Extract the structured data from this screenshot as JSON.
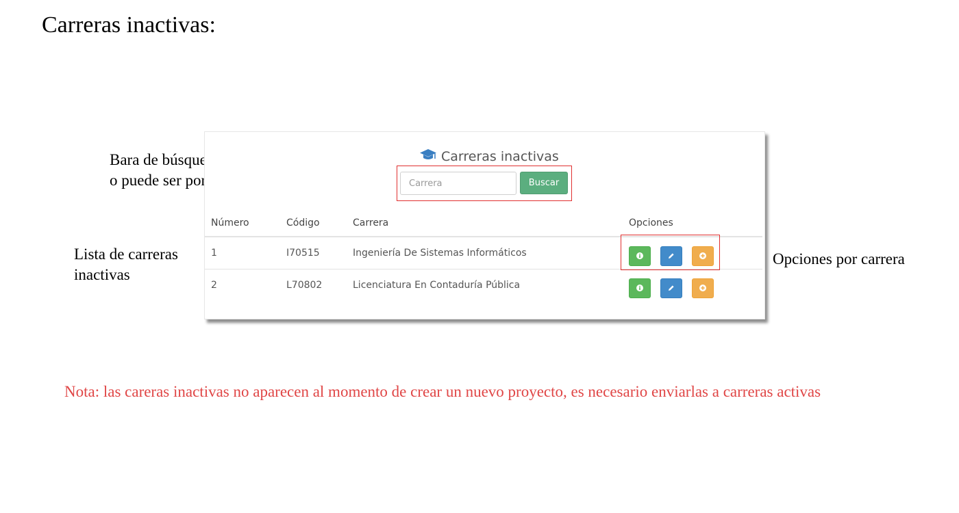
{
  "document": {
    "title": "Carreras inactivas:",
    "annotation_search_line1": "Bara de búsqueda (puede ser por código",
    "annotation_search_line2": "o puede ser por nombre)",
    "annotation_list_line1": "Lista de carreras",
    "annotation_list_line2": "inactivas",
    "annotation_options": "Opciones por carrera",
    "note": "Nota: las careras inactivas no aparecen al momento de crear un nuevo proyecto, es necesario enviarlas a carreras activas"
  },
  "panel": {
    "title": "Carreras inactivas",
    "title_icon": "graduation-cap-icon",
    "search_placeholder": "Carrera",
    "search_button": "Buscar"
  },
  "table": {
    "headers": [
      "Número",
      "Código",
      "Carrera",
      "Opciones"
    ],
    "rows": [
      {
        "numero": "1",
        "codigo": "I70515",
        "carrera": "Ingeniería De Sistemas Informáticos"
      },
      {
        "numero": "2",
        "codigo": "L70802",
        "carrera": "Licenciatura En Contaduría Pública"
      }
    ],
    "option_icons": [
      "info-icon",
      "pencil-icon",
      "plus-circle-icon"
    ]
  },
  "colors": {
    "search_button": "#5bae7f",
    "info_button": "#5cb85c",
    "edit_button": "#428bca",
    "activate_button": "#f0ad4e",
    "highlight_box": "#e02f2f",
    "note_text": "#e04646",
    "title_icon": "#3a7fc2"
  }
}
